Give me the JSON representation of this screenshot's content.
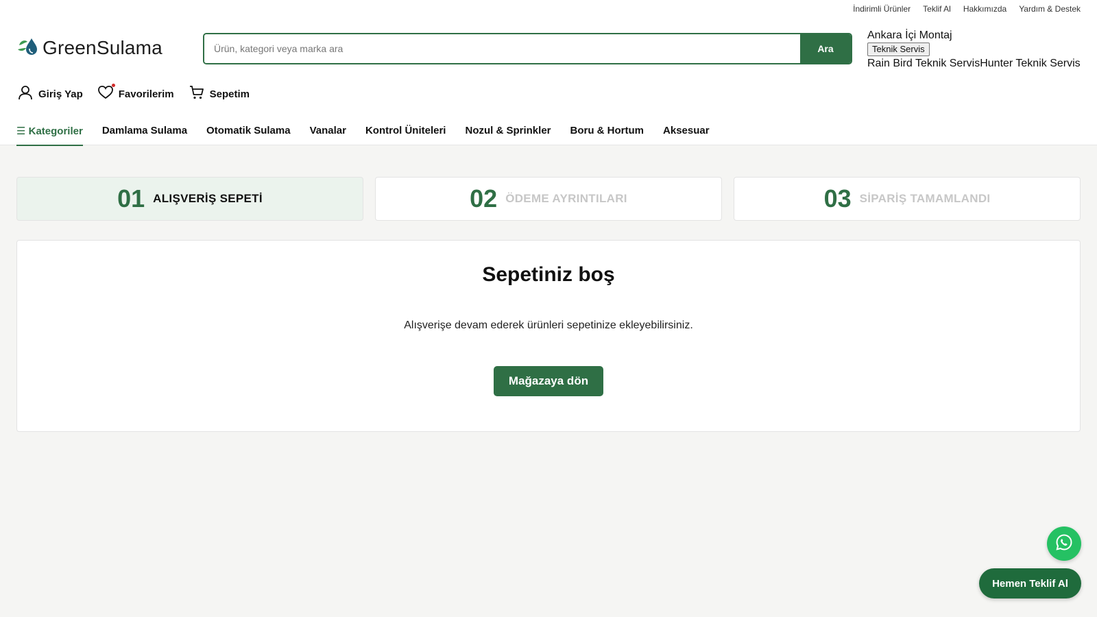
{
  "topbar": {
    "links": [
      "İndirimli Ürünler",
      "Teklif Al",
      "Hakkımızda",
      "Yardım & Destek"
    ]
  },
  "logo": {
    "text": "GreenSulama",
    "icon": "leaf-drop-icon",
    "accent": "#2f6f45"
  },
  "search": {
    "placeholder": "Ürün, kategori veya marka ara",
    "value": "",
    "button_label": "Ara"
  },
  "service": {
    "line1": "Ankara İçi Montaj",
    "button_label": "Teknik Servis",
    "link1": "Rain Bird Teknik Servis",
    "link2": "Hunter Teknik Servis"
  },
  "account": {
    "login": {
      "label": "Giriş Yap",
      "icon": "user-icon"
    },
    "favorites": {
      "label": "Favorilerim",
      "icon": "heart-icon"
    },
    "cart": {
      "label": "Sepetim",
      "icon": "cart-icon"
    }
  },
  "nav": {
    "categories_label": "☰ Kategoriler",
    "items": [
      "Damlama Sulama",
      "Otomatik Sulama",
      "Vanalar",
      "Kontrol Üniteleri",
      "Nozul & Sprinkler",
      "Boru & Hortum",
      "Aksesuar"
    ]
  },
  "steps": [
    {
      "num": "01",
      "label": "ALIŞVERİŞ SEPETİ",
      "active": true
    },
    {
      "num": "02",
      "label": "ÖDEME AYRINTILARI",
      "active": false
    },
    {
      "num": "03",
      "label": "SİPARİŞ TAMAMLANDI",
      "active": false
    }
  ],
  "cart": {
    "title": "Sepetiniz boş",
    "message": "Alışverişe devam ederek ürünleri sepetinize ekleyebilirsiniz.",
    "button_label": "Mağazaya dön"
  },
  "floating": {
    "whatsapp_icon": "whatsapp-icon",
    "quote_label": "Hemen Teklif Al"
  },
  "colors": {
    "brand": "#2f6f45",
    "whatsapp": "#25c163",
    "active_step_bg": "#ebf3ed"
  }
}
